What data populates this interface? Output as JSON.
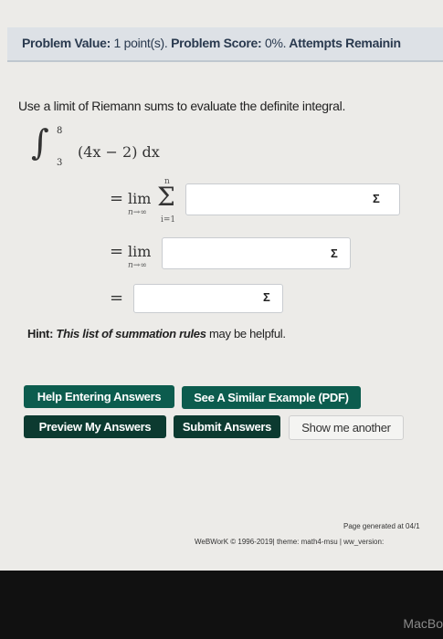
{
  "status": {
    "value_label": "Problem Value:",
    "value_text": "1 point(s).",
    "score_label": "Problem Score:",
    "score_text": "0%.",
    "attempts_label": "Attempts Remainin"
  },
  "problem": {
    "prompt": "Use a limit of Riemann sums to evaluate the definite integral.",
    "upper_limit": "8",
    "lower_limit": "3",
    "integrand": "(4x − 2) dx",
    "row1": {
      "eq": "=",
      "lim": "lim",
      "sub": "n→∞",
      "sigma": "Σ",
      "sigma_top": "n",
      "sigma_bottom": "i=1",
      "btn": "Σ"
    },
    "row2": {
      "eq": "=",
      "lim": "lim",
      "sub": "n→∞",
      "btn": "Σ"
    },
    "row3": {
      "eq": "=",
      "btn": "Σ"
    }
  },
  "hint": {
    "label": "Hint:",
    "text": "This list of summation rules",
    "suffix": "may be helpful."
  },
  "buttons": {
    "help": "Help Entering Answers",
    "similar": "See A Similar Example (PDF)",
    "preview": "Preview My Answers",
    "submit": "Submit Answers",
    "show_another": "Show me another"
  },
  "footer": {
    "generated": "Page generated at 04/1",
    "credits": "WeBWorK © 1996-2019| theme: math4-msu | ww_version: "
  },
  "device": {
    "label": "MacBo"
  }
}
